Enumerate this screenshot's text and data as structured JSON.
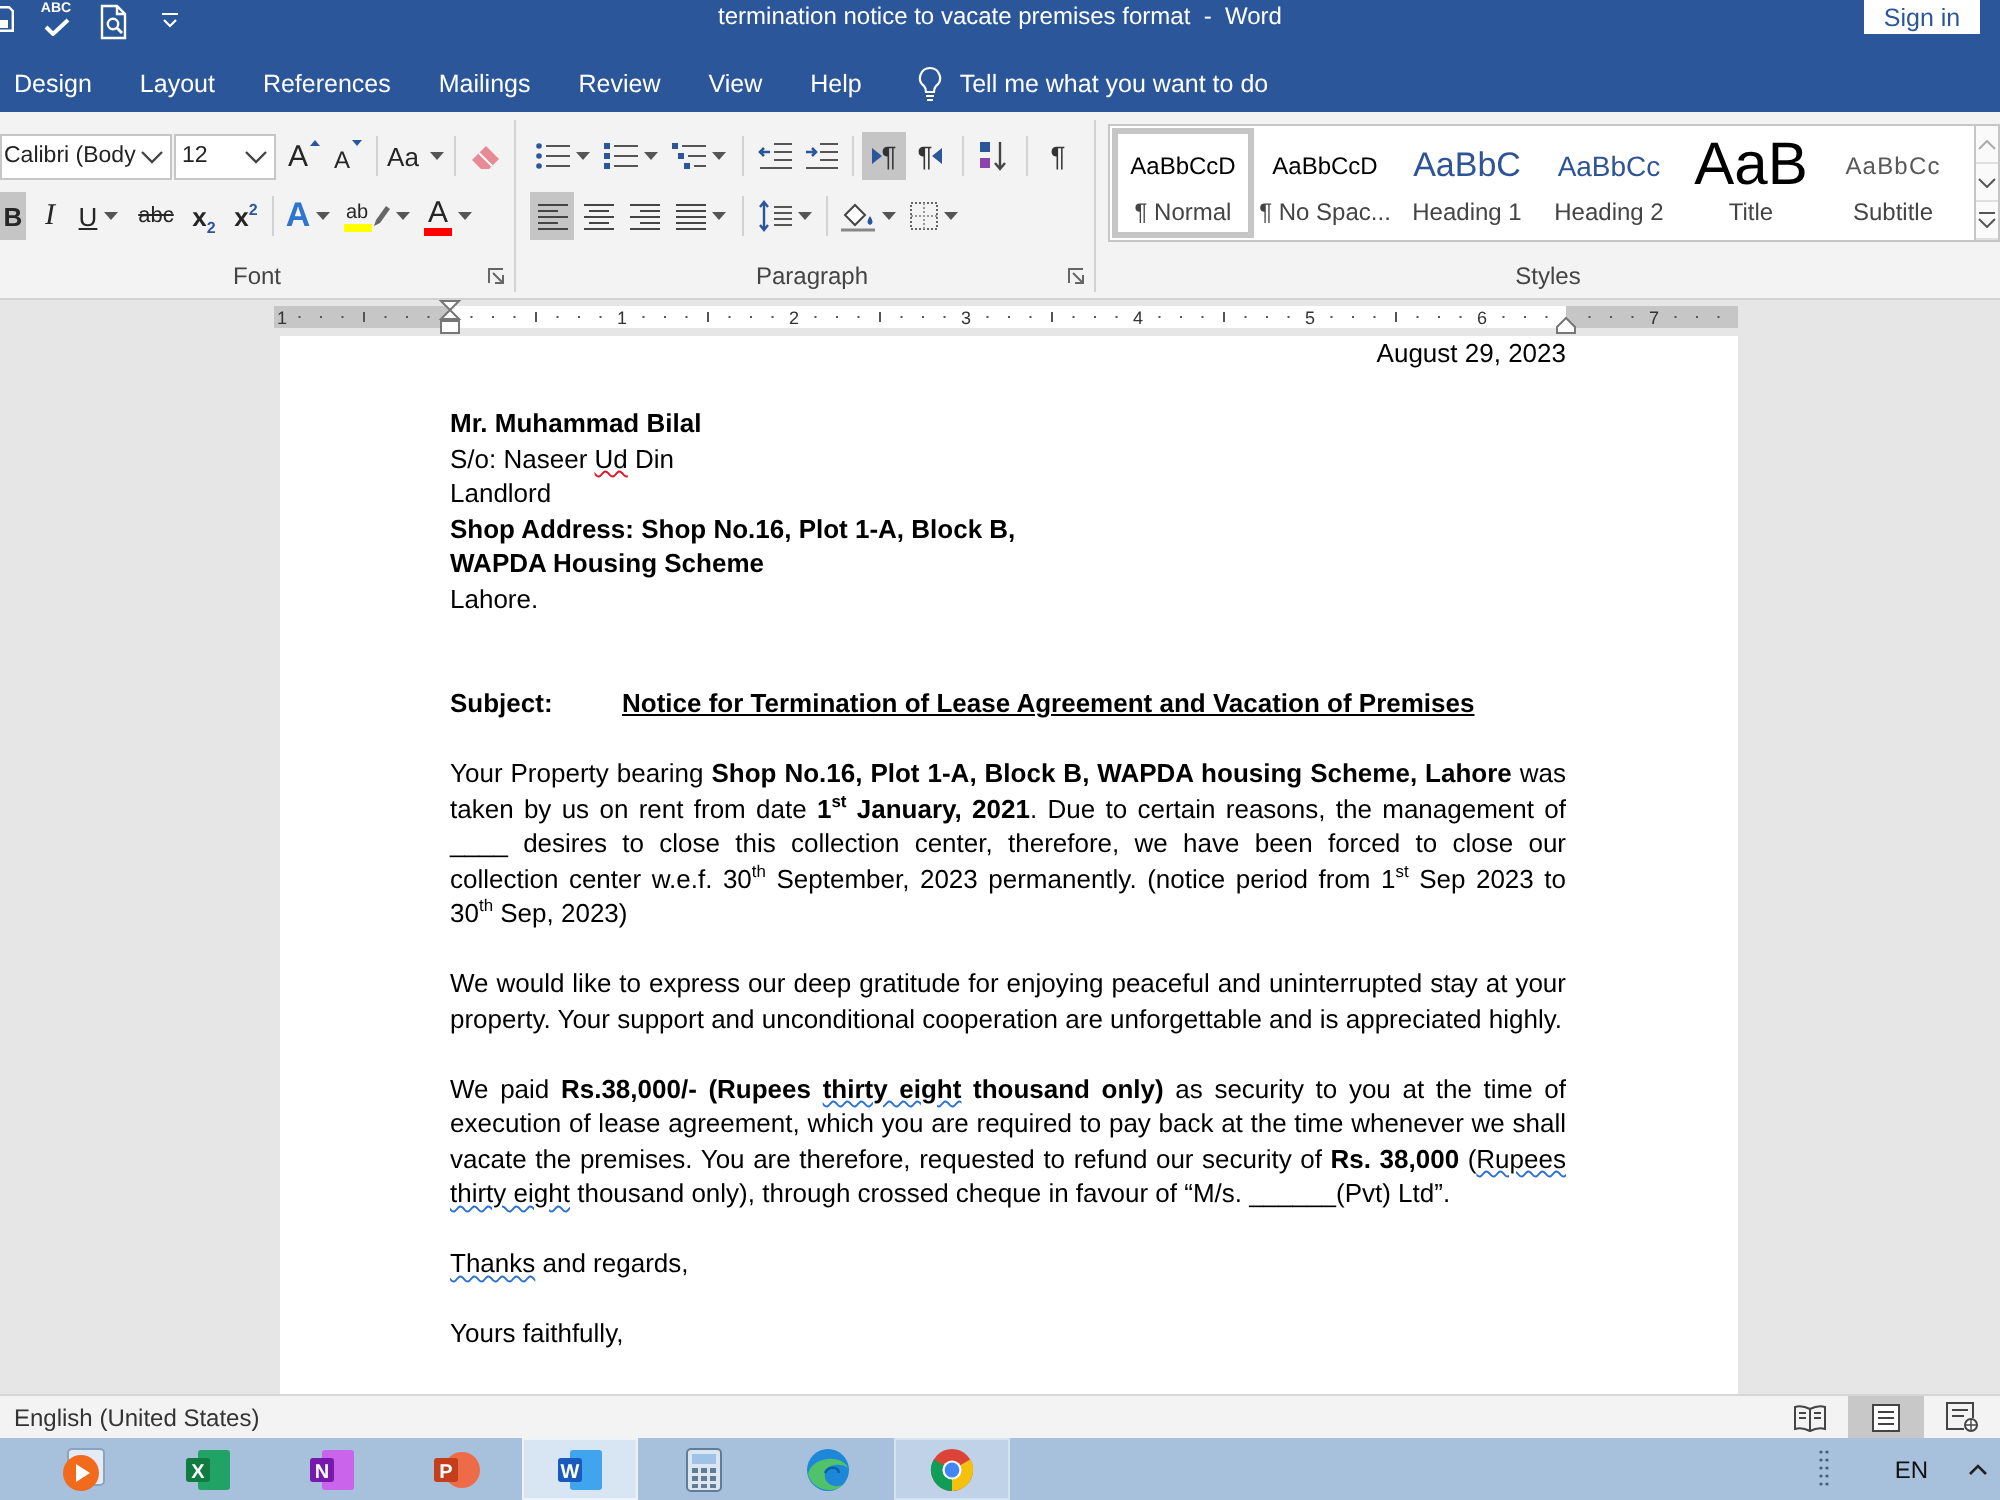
{
  "window": {
    "title": "termination notice to vacate premises format  -  Word",
    "sign_in": "Sign in"
  },
  "quick_access": {
    "spelling_label": "ABC"
  },
  "tabs": [
    {
      "label": "Design",
      "selected": false
    },
    {
      "label": "Layout",
      "selected": false
    },
    {
      "label": "References",
      "selected": false
    },
    {
      "label": "Mailings",
      "selected": false
    },
    {
      "label": "Review",
      "selected": false
    },
    {
      "label": "View",
      "selected": false
    },
    {
      "label": "Help",
      "selected": false
    }
  ],
  "tell_me": "Tell me what you want to do",
  "font_group": {
    "font_name": "Calibri (Body",
    "font_size": "12",
    "grow_label": "A",
    "shrink_label": "A",
    "case_label": "Aa",
    "format_buttons": [
      {
        "kind": "bold",
        "label": "B",
        "on": true
      },
      {
        "kind": "italic",
        "label": "I",
        "on": false
      },
      {
        "kind": "underline",
        "label": "U",
        "on": false
      },
      {
        "kind": "strikethrough",
        "label": "abc",
        "on": false
      },
      {
        "kind": "subscript",
        "label": "x$_{2}$",
        "on": false
      },
      {
        "kind": "superscript",
        "label": "x$^{2}$",
        "on": false
      }
    ],
    "effects_label": "A",
    "highlight_label": "ab",
    "color_label": "A",
    "label": "Font"
  },
  "paragraph_group": {
    "row_1": [
      {
        "kind": "bullets",
        "on": false
      },
      {
        "kind": "numbering",
        "on": false
      },
      {
        "kind": "multilevel",
        "on": false
      },
      {
        "kind": "decrease-indent",
        "on": false
      },
      {
        "kind": "increase-indent",
        "on": false
      },
      {
        "kind": "ltr",
        "label": "¶",
        "on": true
      },
      {
        "kind": "rtl",
        "label": "¶",
        "on": false
      },
      {
        "kind": "sort",
        "on": false
      },
      {
        "kind": "show-marks",
        "label": "¶",
        "on": false
      }
    ],
    "row_2": [
      {
        "kind": "align-left",
        "on": true
      },
      {
        "kind": "align-center",
        "on": false
      },
      {
        "kind": "align-right",
        "on": false
      },
      {
        "kind": "justify",
        "on": false
      },
      {
        "kind": "line-spacing",
        "on": false
      },
      {
        "kind": "shading",
        "on": false
      },
      {
        "kind": "borders",
        "on": false
      }
    ],
    "label": "Paragraph"
  },
  "styles_group": {
    "items": [
      {
        "kind": "normal",
        "preview": "AaBbCcD",
        "name": "¶ Normal",
        "selected": true
      },
      {
        "kind": "no-spacing",
        "preview": "AaBbCcD",
        "name": "¶ No Spac...",
        "selected": false
      },
      {
        "kind": "heading-1",
        "preview": "AaBbC",
        "name": "Heading 1",
        "selected": false
      },
      {
        "kind": "heading-2",
        "preview": "AaBbCc",
        "name": "Heading 2",
        "selected": false
      },
      {
        "kind": "title",
        "preview": "AaB",
        "name": "Title",
        "selected": false
      },
      {
        "kind": "subtitle",
        "preview": "AaBbCc",
        "name": "Subtitle",
        "selected": false
      }
    ],
    "label": "Styles"
  },
  "ruler": {
    "labels": [
      "1",
      "1",
      "2",
      "3",
      "4",
      "5",
      "6",
      "7"
    ]
  },
  "document": {
    "blocks": [
      {
        "kind": "date",
        "text": "August 29, 2023"
      },
      {
        "kind": "address",
        "lines": [
          {
            "bold": true,
            "parts": [
              {
                "text": "Mr. Muhammad Bilal"
              }
            ]
          },
          {
            "bold": false,
            "parts": [
              {
                "text": "S/o: Naseer "
              },
              {
                "text": "Ud",
                "spelling_error": true
              },
              {
                "text": " Din"
              }
            ]
          },
          {
            "bold": false,
            "parts": [
              {
                "text": "Landlord"
              }
            ]
          },
          {
            "bold": true,
            "parts": [
              {
                "text": "Shop Address: Shop No.16, Plot 1-A, Block B,"
              }
            ]
          },
          {
            "bold": true,
            "parts": [
              {
                "text": "WAPDA Housing Scheme"
              }
            ]
          },
          {
            "bold": false,
            "parts": [
              {
                "text": "Lahore."
              }
            ]
          }
        ]
      },
      {
        "kind": "subject",
        "label": "Subject:",
        "title": "Notice for Termination of Lease Agreement and Vacation of Premises"
      },
      {
        "kind": "body",
        "parts": [
          {
            "text": "Your Property bearing **Shop No.16, Plot 1-A, Block B, WAPDA housing Scheme, Lahore** was taken by us on rent from date **1$^{st}$ January, 2021**. Due to certain reasons, the management of ____ desires to close this collection center, therefore, we have been forced to close our collection center w.e.f. 30$^{th}$ September, 2023 permanently. (notice period from 1$^{st}$ Sep 2023 to 30$^{th}$ Sep, 2023)"
          }
        ]
      },
      {
        "kind": "body",
        "parts": [
          {
            "text": "We would like to express our deep gratitude for enjoying peaceful and uninterrupted stay at your property. Your support and unconditional cooperation are unforgettable and is appreciated highly."
          }
        ]
      },
      {
        "kind": "body",
        "parts": [
          {
            "text": "We paid **Rs.38,000/- (Rupees** "
          },
          {
            "text": "**thirty eight**",
            "grammar_error": true
          },
          {
            "text": " **thousand only)** as security to you at the time of execution of lease agreement, which you are required to pay back at the time whenever we shall vacate the premises. You are therefore, requested to refund our security of **Rs. 38,000** ("
          },
          {
            "text": "Rupees thirty eight",
            "grammar_error": true
          },
          {
            "text": " thousand only), through crossed cheque in favour of “M/s. ______(Pvt) Ltd”."
          }
        ]
      },
      {
        "kind": "closing",
        "parts": [
          {
            "text": "Thanks",
            "grammar_error": true
          },
          {
            "text": " and regards,"
          }
        ]
      },
      {
        "kind": "closing",
        "parts": [
          {
            "text": "Yours faithfully,"
          }
        ]
      }
    ]
  },
  "status_bar": {
    "language": "English (United States)",
    "views": [
      {
        "kind": "read-mode",
        "selected": false
      },
      {
        "kind": "print-layout",
        "selected": true
      },
      {
        "kind": "web-layout",
        "selected": false
      }
    ]
  },
  "taskbar": {
    "apps": [
      {
        "kind": "media",
        "open": false,
        "active": false
      },
      {
        "kind": "excel",
        "letter": "X",
        "open": false,
        "active": false
      },
      {
        "kind": "onenote",
        "letter": "N",
        "open": false,
        "active": false
      },
      {
        "kind": "powerpoint",
        "letter": "P",
        "open": false,
        "active": false
      },
      {
        "kind": "word",
        "letter": "W",
        "open": true,
        "active": true
      },
      {
        "kind": "calculator",
        "open": false,
        "active": false
      },
      {
        "kind": "edge",
        "open": false,
        "active": false
      },
      {
        "kind": "chrome",
        "open": true,
        "active": false
      }
    ],
    "language": "EN"
  }
}
